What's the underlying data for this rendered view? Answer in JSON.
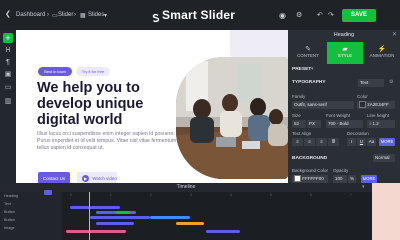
{
  "topbar": {
    "crumb_dashboard": "Dashboard",
    "crumb_slider": "Slider",
    "crumb_slides": "Slides",
    "brand": "Smart Slider",
    "save_label": "SAVE"
  },
  "slide": {
    "pill_primary": "Best in town",
    "pill_secondary": "Try it for free",
    "headline": "We help you to develop unique digital world",
    "paragraph": "Illius lacus orci suspendisse enim integer sapien id posuere. Purus imperdiet et id velit tempus. Vitae nisl vitae fermentum tellus sapien id consequat ut.",
    "cta_label": "Contact Us",
    "watch_label": "Watch video"
  },
  "panel": {
    "title": "Heading",
    "tabs": [
      {
        "label": "CONTENT"
      },
      {
        "label": "STYLE"
      },
      {
        "label": "ANIMATION"
      }
    ],
    "preset_label": "PRESET",
    "typography_label": "TYPOGRAPHY",
    "text_select": "Text",
    "family_label": "Family",
    "family_value": "Outfit, sans-serif",
    "color_label": "Color",
    "color_value": "2A2E34FF",
    "size_label": "Size",
    "size_value": "52",
    "size_unit": "PX",
    "weight_label": "Font Weight",
    "weight_value": "700 - Bold",
    "lineheight_label": "Line height",
    "lineheight_value": "1.2",
    "align_label": "Text Align",
    "decoration_label": "Decoration",
    "more_label": "MORE",
    "background_label": "BACKGROUND",
    "background_mode": "Normal",
    "bg_color_label": "Background Color",
    "bg_color_value": "FFFFFF00",
    "opacity_label": "Opacity",
    "opacity_value": "100",
    "opacity_unit": "%",
    "more2_label": "MORE"
  },
  "timeline": {
    "title": "Timeline",
    "rows": [
      "Heading",
      "Text",
      "Button",
      "Button",
      "Image"
    ],
    "ticks": [
      "0",
      "1",
      "2",
      "3",
      "4",
      "5",
      "6",
      "7"
    ]
  },
  "colors": {
    "accent": "#6a5ae0",
    "save_green": "#13bf3f",
    "panel_bg": "#2a2e35",
    "topbar_bg": "#1f2328",
    "more_blue": "#5b60e8"
  }
}
